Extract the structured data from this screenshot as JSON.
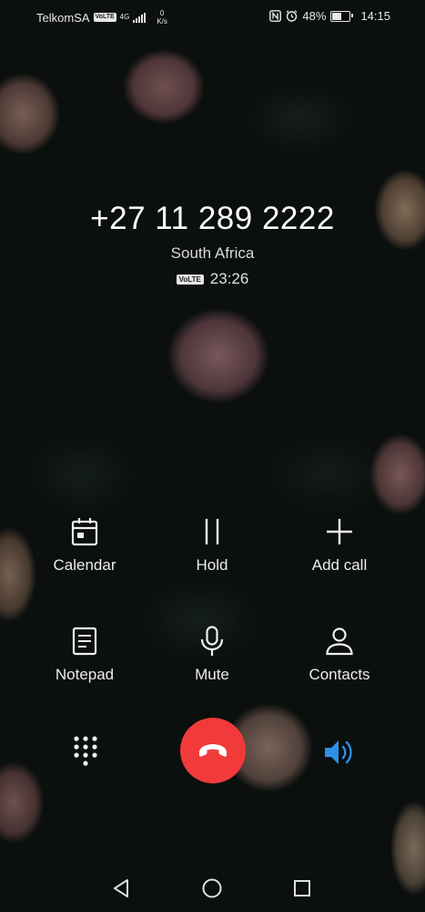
{
  "status_bar": {
    "carrier": "TelkomSA",
    "volte_badge": "VoLTE",
    "network": "4G",
    "speed_value": "0",
    "speed_unit": "K/s",
    "battery": "48%",
    "battery_level": 0.48,
    "time": "14:15"
  },
  "call": {
    "number": "+27 11 289 2222",
    "location": "South Africa",
    "volte_badge": "VoLTE",
    "duration": "23:26"
  },
  "actions": {
    "calendar": "Calendar",
    "hold": "Hold",
    "add_call": "Add call",
    "notepad": "Notepad",
    "mute": "Mute",
    "contacts": "Contacts"
  },
  "colors": {
    "end_call": "#f23a3a",
    "speaker_active": "#2e8fe6"
  },
  "icons": [
    "calendar-icon",
    "pause-icon",
    "plus-icon",
    "notepad-icon",
    "microphone-icon",
    "person-icon",
    "dialpad-icon",
    "phone-hangup-icon",
    "speaker-icon",
    "back-icon",
    "home-icon",
    "recents-icon"
  ]
}
